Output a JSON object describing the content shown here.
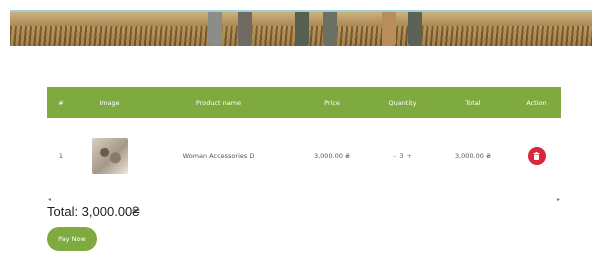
{
  "table": {
    "headers": {
      "num": "#",
      "image": "Image",
      "product_name": "Product name",
      "price": "Price",
      "quantity": "Quantity",
      "total": "Total",
      "action": "Action"
    },
    "rows": [
      {
        "num": "1",
        "product_name": "Woman Accessories D",
        "price": "3,000.00 ₴",
        "quantity": "3",
        "total": "3,000.00 ₴"
      }
    ]
  },
  "quantity_controls": {
    "minus": "–",
    "plus": "+"
  },
  "scroll": {
    "left": "◂",
    "right": "▸"
  },
  "summary": {
    "total_text": "Total: 3,000.00₴"
  },
  "buttons": {
    "pay_now": "Pay Now"
  },
  "colors": {
    "accent": "#7eaa3f",
    "delete": "#d7263d"
  }
}
